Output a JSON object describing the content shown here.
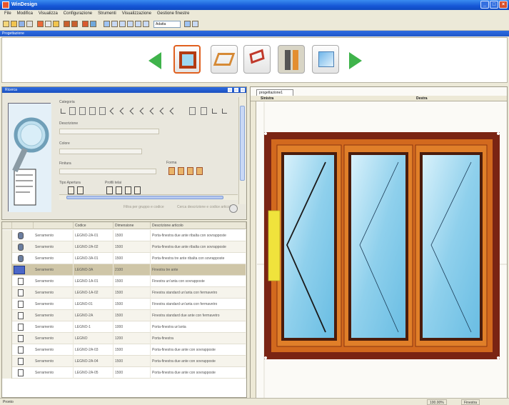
{
  "window": {
    "title": "WinDesign"
  },
  "menu": {
    "items": [
      "File",
      "Modifica",
      "Visualizza",
      "Configurazione",
      "Strumenti",
      "Visualizzazione",
      "Gestione finestre"
    ]
  },
  "toolbar": {
    "zoom_value": "Adatta"
  },
  "wizard": {
    "header": "Progettazione"
  },
  "left_panel": {
    "title": "Ricerca",
    "name_label": "Ricerca",
    "labels": {
      "category": "Categoria",
      "description": "Descrizione",
      "color": "Colore",
      "finish": "Finitura",
      "shape": "Forma",
      "available": "Tipo Apertura",
      "frames": "Profili telai"
    },
    "hint_left": "Filtra per gruppo e codice",
    "hint_right": "Cerca descrizione e codice articolo"
  },
  "grid": {
    "columns": [
      "",
      "",
      "",
      "Codice",
      "Dimensione",
      "Descrizione articolo"
    ],
    "rows": [
      {
        "group": "Serramento",
        "code": "LEGNO-2A-01",
        "dim": "1500",
        "desc": "Porta-finestra due ante ribalta con sovrapposte",
        "icon": "dark"
      },
      {
        "group": "Serramento",
        "code": "LEGNO-2A-02",
        "dim": "1500",
        "desc": "Porta-finestra due ante ribalta con sovrapposte",
        "icon": "dark"
      },
      {
        "group": "Serramento",
        "code": "LEGNO-3A-01",
        "dim": "1500",
        "desc": "Porta-finestra tre ante ribalta con sovrapposte",
        "icon": "dark"
      },
      {
        "group": "Serramento",
        "code": "LEGNO-3A",
        "dim": "2100",
        "desc": "Finestra tre ante",
        "icon": "dark",
        "selected": true
      },
      {
        "group": "Serramento",
        "code": "LEGNO-1A-01",
        "dim": "1500",
        "desc": "Finestra un'anta con sovrapposte",
        "icon": "light"
      },
      {
        "group": "Serramento",
        "code": "LEGNO-1A-02",
        "dim": "1500",
        "desc": "Finestra standard un'anta con fermavetro",
        "icon": "light"
      },
      {
        "group": "Serramento",
        "code": "LEGNO-01",
        "dim": "1500",
        "desc": "Finestra standard un'anta con fermavetro",
        "icon": "light"
      },
      {
        "group": "Serramento",
        "code": "LEGNO-2A",
        "dim": "1500",
        "desc": "Finestra standard due ante con fermavetro",
        "icon": "light"
      },
      {
        "group": "Serramento",
        "code": "LEGNO-1",
        "dim": "1000",
        "desc": "Porta-finestra un'anta",
        "icon": "light"
      },
      {
        "group": "Serramento",
        "code": "LEGNO",
        "dim": "1200",
        "desc": "Porta-finestra",
        "icon": "light"
      },
      {
        "group": "Serramento",
        "code": "LEGNO-2A-03",
        "dim": "1500",
        "desc": "Porta-finestra due ante con sovrapposte",
        "icon": "light"
      },
      {
        "group": "Serramento",
        "code": "LEGNO-2A-04",
        "dim": "1500",
        "desc": "Porta-finestra due ante con sovrapposte",
        "icon": "light"
      },
      {
        "group": "Serramento",
        "code": "LEGNO-2A-05",
        "dim": "1500",
        "desc": "Porta-finestra due ante con sovrapposte",
        "icon": "light"
      }
    ]
  },
  "drawing": {
    "tab_label": "progettazione1",
    "ruler_left_label": "Sinistra",
    "ruler_right_label": "Destra",
    "colors": {
      "frame_outer": "#7a2413",
      "frame_inner": "#d2691e",
      "glass": "#8fd0ec",
      "handle": "#f0e33c"
    }
  },
  "status": {
    "text": "Pronto",
    "panel_1": "100.00%",
    "panel_2": "Finestra"
  }
}
